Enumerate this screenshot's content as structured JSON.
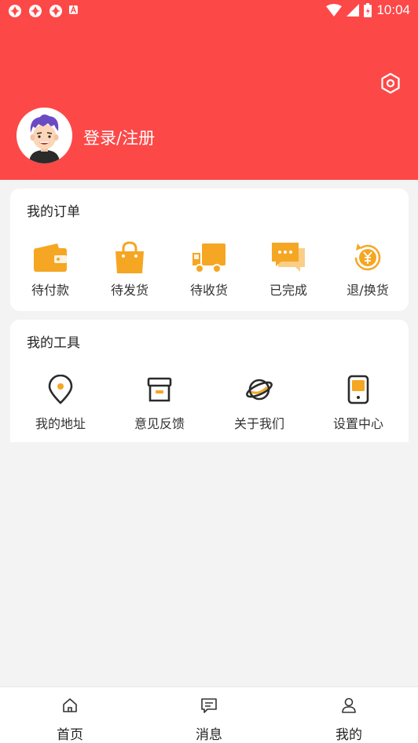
{
  "status_bar": {
    "time": "10:04",
    "left_icons": [
      "app-notification-icon",
      "app-notification-icon",
      "app-notification-icon",
      "font-a-icon"
    ],
    "right_icons": [
      "wifi-icon",
      "signal-icon",
      "battery-icon"
    ]
  },
  "header": {
    "login_label": "登录/注册",
    "settings_icon": "hexagon-settings-icon",
    "bg_color": "#fd4848"
  },
  "orders": {
    "title": "我的订单",
    "items": [
      {
        "label": "待付款",
        "icon": "wallet-icon"
      },
      {
        "label": "待发货",
        "icon": "shopping-bag-icon"
      },
      {
        "label": "待收货",
        "icon": "truck-icon"
      },
      {
        "label": "已完成",
        "icon": "chat-bubble-icon"
      },
      {
        "label": "退/换货",
        "icon": "refund-yuan-icon"
      }
    ],
    "accent_color": "#f5a623"
  },
  "tools": {
    "title": "我的工具",
    "items": [
      {
        "label": "我的地址",
        "icon": "location-pin-icon"
      },
      {
        "label": "意见反馈",
        "icon": "archive-box-icon"
      },
      {
        "label": "关于我们",
        "icon": "planet-icon"
      },
      {
        "label": "设置中心",
        "icon": "phone-device-icon"
      }
    ]
  },
  "tabbar": {
    "items": [
      {
        "label": "首页",
        "icon": "home-icon"
      },
      {
        "label": "消息",
        "icon": "message-icon"
      },
      {
        "label": "我的",
        "icon": "user-icon"
      }
    ]
  }
}
